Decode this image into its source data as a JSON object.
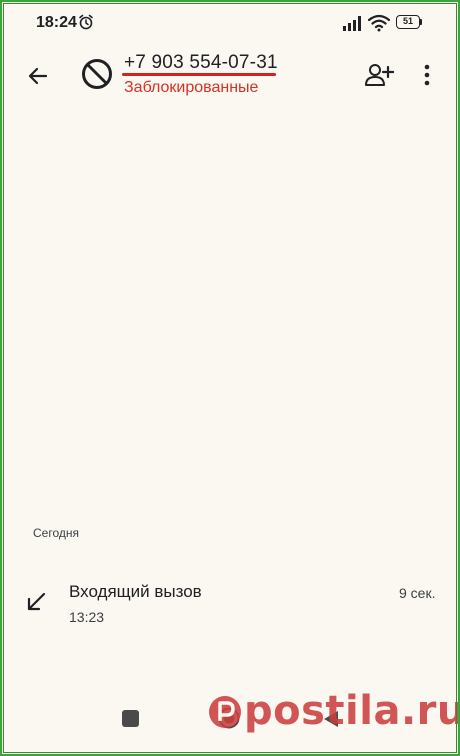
{
  "status_bar": {
    "time": "18:24",
    "alarm_icon": "alarm-clock-icon",
    "signal_icon": "cellular-signal-icon",
    "wifi_icon": "wifi-icon",
    "battery_level": "51"
  },
  "app_bar": {
    "back_icon": "arrow-back-icon",
    "avatar_icon": "blocked-icon",
    "phone_number": "+7 903 554-07-31",
    "status_label": "Заблокированные",
    "add_contact_icon": "person-add-icon",
    "more_icon": "more-vert-icon"
  },
  "history": {
    "section_title": "Сегодня",
    "calls": [
      {
        "type": "Входящий вызов",
        "time": "13:23",
        "duration": "9 сек.",
        "icon": "incoming-call-arrow-icon"
      }
    ]
  },
  "nav_bar": {
    "recents_icon": "recents-square-icon",
    "home_icon": "home-circle-icon",
    "back_icon": "back-triangle-icon"
  },
  "watermark": {
    "text": "postila.ru"
  },
  "colors": {
    "background": "#fbf8f2",
    "frame_green": "#3aa63a",
    "blocked_red": "#d93025",
    "watermark_red": "#c93d3d"
  }
}
